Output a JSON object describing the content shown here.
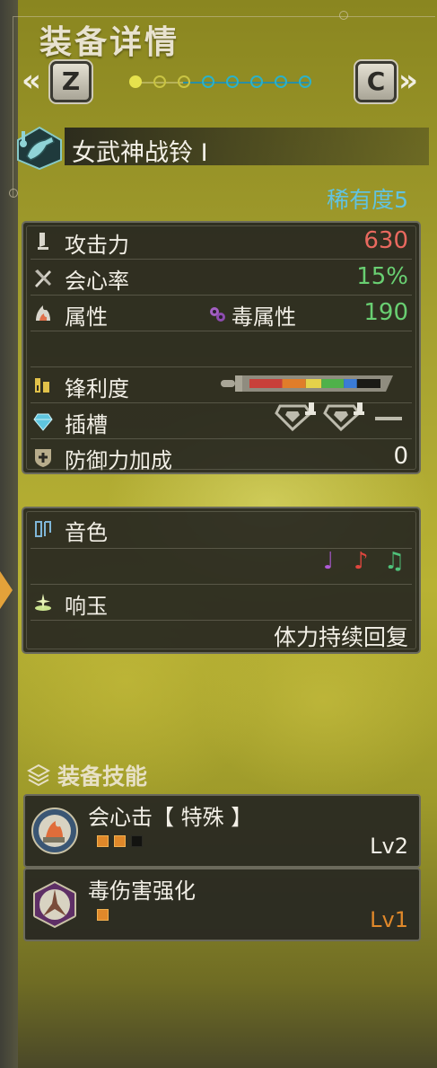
{
  "header": {
    "title": "装备详情",
    "left_key": "Z",
    "right_key": "C",
    "left_chevron": "«",
    "right_chevron": "»",
    "page_dots": {
      "total": 8,
      "current": 1
    }
  },
  "weapon": {
    "name": "女武神战铃 Ⅰ",
    "rarity": "稀有度5",
    "icon": "hunting-horn-icon"
  },
  "stats": {
    "attack": {
      "label": "攻击力",
      "value": "630",
      "color": "#e9695f",
      "icon": "sword-icon"
    },
    "affinity": {
      "label": "会心率",
      "value": "15%",
      "color": "#69cf72",
      "icon": "crossed-blades-icon"
    },
    "element": {
      "label": "属性",
      "sub_label": "毒属性",
      "value": "190",
      "color": "#69cf72",
      "icon": "flame-icon",
      "sub_icon": "poison-icon"
    },
    "sharpness": {
      "label": "锋利度",
      "icon": "sharpness-icon",
      "colors": [
        "#c8403a",
        "#e07d2a",
        "#e5d24a",
        "#4fb14a",
        "#3a7bd6",
        "#e8e8e8"
      ],
      "levels": [
        0.25,
        0.18,
        0.12,
        0.17,
        0.1,
        0
      ]
    },
    "slots": {
      "label": "插槽",
      "icon": "gem-icon"
    },
    "defense": {
      "label": "防御力加成",
      "value": "0",
      "color": "#f2efe6",
      "icon": "shield-plus-icon"
    }
  },
  "melody": {
    "label": "音色",
    "icon": "melody-icon",
    "notes": [
      {
        "glyph": "♩",
        "color": "#b05ad8"
      },
      {
        "glyph": "♪",
        "color": "#e0463e"
      },
      {
        "glyph": "♫",
        "color": "#4fc27a"
      }
    ]
  },
  "echo": {
    "label": "响玉",
    "icon": "sparkle-icon",
    "value": "体力持续回复"
  },
  "skills": {
    "title": "装备技能",
    "icon": "skills-stack-icon",
    "items": [
      {
        "name": "会心击【 特殊 】",
        "level": "Lv2",
        "level_color": "#f2efe6",
        "pips_on": 2,
        "pips_total": 3,
        "icon": "critical-element-icon"
      },
      {
        "name": "毒伤害强化",
        "level": "Lv1",
        "level_color": "#e0882a",
        "pips_on": 1,
        "pips_total": 1,
        "icon": "poison-attack-icon"
      }
    ]
  }
}
